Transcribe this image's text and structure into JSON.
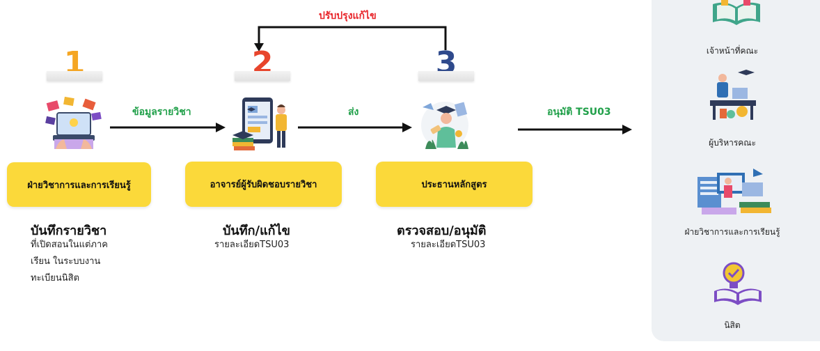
{
  "feedback": {
    "label": "ปรับปรุงแก้ไข"
  },
  "steps": [
    {
      "number": "1",
      "number_color": "#f5a623",
      "role": "ฝ่ายวิชาการและการเรียนรู้",
      "action_title": "บันทึกรายวิชา",
      "action_desc": [
        "ที่เปิดสอนในแต่ภาค",
        "เรียน ในระบบงาน",
        "ทะเบียนนิสิต"
      ]
    },
    {
      "number": "2",
      "number_color": "#e8452c",
      "role": "อาจารย์ผู้รับผิดชอบรายวิชา",
      "action_title": "บันทึก/แก้ไข",
      "action_desc": [
        "รายละเอียดTSU03"
      ]
    },
    {
      "number": "3",
      "number_color": "#2f4a8c",
      "role": "ประธานหลักสูตร",
      "action_title": "ตรวจสอบ/อนุมัติ",
      "action_desc": [
        "รายละเอียดTSU03"
      ]
    }
  ],
  "flow_labels": [
    "ข้อมูลรายวิชา",
    "ส่ง",
    "อนุมัติ TSU03"
  ],
  "sidebar": {
    "items": [
      {
        "label": "เจ้าหน้าที่คณะ",
        "icon": "open-book-icon"
      },
      {
        "label": "ผู้บริหารคณะ",
        "icon": "executive-icon"
      },
      {
        "label": "ฝ่ายวิชาการและการเรียนรู้",
        "icon": "academic-office-icon"
      },
      {
        "label": "นิสิต",
        "icon": "student-book-icon"
      }
    ]
  },
  "colors": {
    "role_box": "#fbd93a",
    "flow_label": "#21a04a",
    "feedback_label": "#e8252a",
    "panel": "#eef1f4"
  }
}
